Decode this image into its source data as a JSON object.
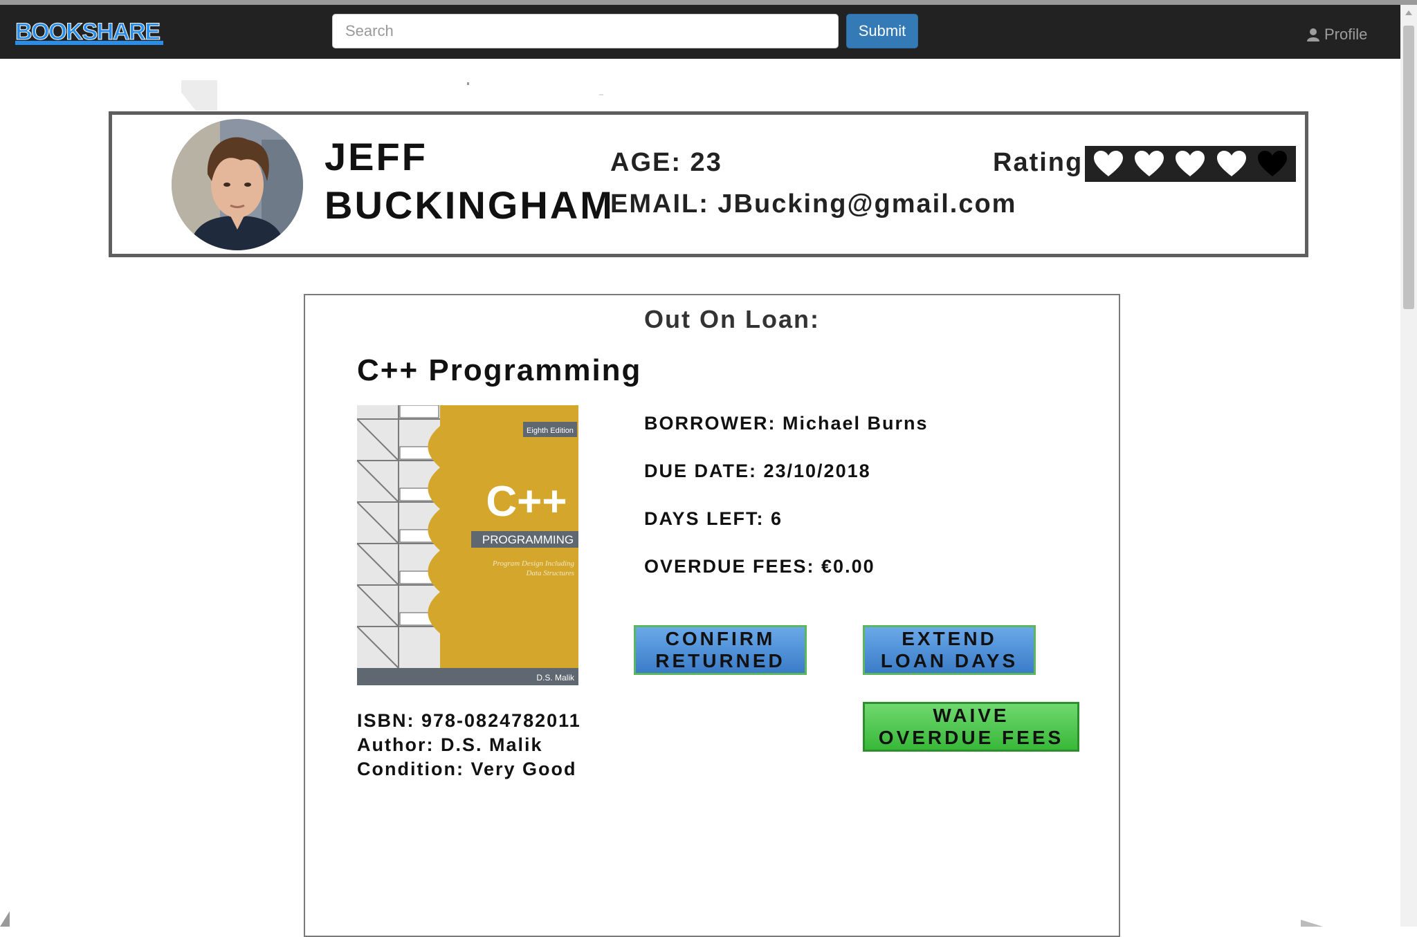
{
  "navbar": {
    "logo_text": "BOOKSHARE",
    "search_placeholder": "Search",
    "submit_label": "Submit",
    "profile_label": "Profile",
    "profile_icon": "user-icon"
  },
  "user": {
    "first_name": "JEFF",
    "last_name": "BUCKINGHAM",
    "age_text": "AGE: 23",
    "email_text": "EMAIL: JBucking@gmail.com",
    "rating_label": "Rating:",
    "rating_value": 5,
    "rating_max": 5,
    "rating_icon": "heart-icon"
  },
  "loan": {
    "heading": "Out On Loan:",
    "book_title": "C++ Programming",
    "cover": {
      "edition": "Eighth Edition",
      "big_text": "C++",
      "subtitle": "PROGRAMMING",
      "tagline_1": "Program Design Including",
      "tagline_2": "Data Structures",
      "author": "D.S. Malik",
      "colors": {
        "panel": "#d4a72c",
        "band": "#5f6870",
        "footer": "#5f6870"
      }
    },
    "borrower": "BORROWER: Michael Burns",
    "due_date": "DUE DATE: 23/10/2018",
    "days_left": "DAYS LEFT: 6",
    "overdue_fees": "OVERDUE FEES: €0.00",
    "isbn": "ISBN: 978-0824782011",
    "author": "Author: D.S. Malik",
    "condition": "Condition: Very Good",
    "buttons": {
      "confirm_returned": "CONFIRM\nRETURNED",
      "extend_loan_days": "EXTEND\nLOAN DAYS",
      "waive_overdue_fees": "WAIVE\nOVERDUE FEES"
    }
  },
  "colors": {
    "navbar_bg": "#222222",
    "submit_bg": "#337ab7",
    "logo_blue": "#2a8de8",
    "blue_button": "#3b7cc8",
    "green_button": "#38b838"
  }
}
